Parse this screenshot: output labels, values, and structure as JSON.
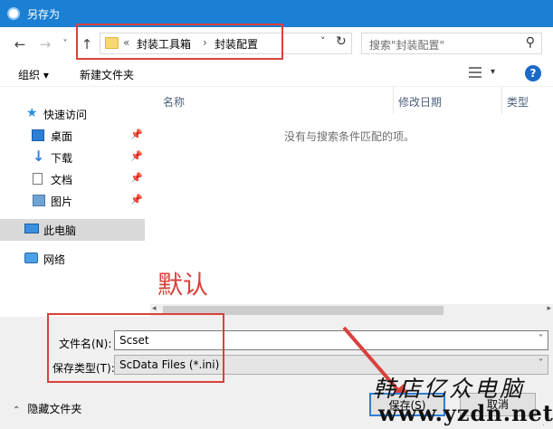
{
  "window": {
    "title": "另存为"
  },
  "nav": {
    "back": "←",
    "forward": "→",
    "recent": "˅",
    "up": "↑",
    "address": {
      "overflow": "«",
      "crumbs": [
        "封装工具箱",
        "封装配置"
      ],
      "sep": "›",
      "dropdown": "˅",
      "refresh": "↻"
    },
    "search_placeholder": "搜索\"封装配置\"",
    "search_icon": "⚲"
  },
  "toolbar": {
    "organize": "组织 ▾",
    "new_folder": "新建文件夹",
    "help": "?",
    "view_dropdown": "▾"
  },
  "sidebar": {
    "items": [
      {
        "label": "快速访问",
        "icon": "star-icon",
        "glyph": "★"
      },
      {
        "label": "桌面",
        "icon": "desktop-icon",
        "pinned": "📌"
      },
      {
        "label": "下载",
        "icon": "download-icon",
        "glyph": "↓",
        "pinned": "📌"
      },
      {
        "label": "文档",
        "icon": "document-icon",
        "pinned": "📌"
      },
      {
        "label": "图片",
        "icon": "picture-icon",
        "pinned": "📌"
      },
      {
        "label": "此电脑",
        "icon": "computer-icon"
      },
      {
        "label": "网络",
        "icon": "network-icon"
      }
    ]
  },
  "files": {
    "columns": [
      "名称",
      "修改日期",
      "类型"
    ],
    "empty_message": "没有与搜索条件匹配的项。"
  },
  "overlay_label": "默认",
  "form": {
    "filename_label": "文件名(N):",
    "filename_value": "Scset",
    "filetype_label": "保存类型(T):",
    "filetype_value": "ScData Files (*.ini)",
    "dropdown": "˅"
  },
  "footer": {
    "hide_folders": "隐藏文件夹",
    "caret": "⌃",
    "save_button": "保存(S)",
    "cancel_button": "取消"
  },
  "watermark": {
    "text": "韩店亿众电脑",
    "url": "www.yzdn.net"
  },
  "colors": {
    "titlebar": "#1b7fd3",
    "annotation": "#d9413c",
    "selected": "#d9d9d9"
  }
}
